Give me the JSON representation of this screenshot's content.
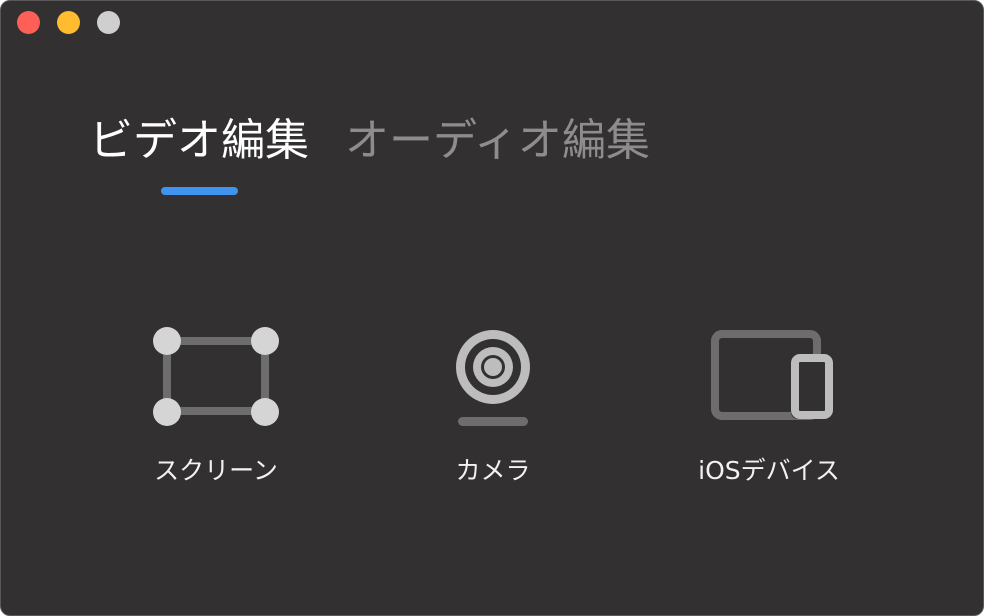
{
  "window": {
    "background": "#323031",
    "traffic_lights": {
      "close": "#fe5f57",
      "minimize": "#febc2e",
      "zoom": "#cfcfcf"
    }
  },
  "tabs": {
    "items": [
      {
        "label": "ビデオ編集",
        "active": true
      },
      {
        "label": "オーディオ編集",
        "active": false
      }
    ],
    "active_color": "#ffffff",
    "inactive_color": "#8e8c8d",
    "underline_color": "#3f95ee"
  },
  "options": [
    {
      "label": "スクリーン",
      "icon": "screen-region-icon"
    },
    {
      "label": "カメラ",
      "icon": "webcam-icon"
    },
    {
      "label": "iOSデバイス",
      "icon": "ios-device-icon"
    }
  ],
  "icon_colors": {
    "light": "#d5d5d5",
    "mid": "#bdbdbd",
    "dark": "#6e6d6e"
  }
}
